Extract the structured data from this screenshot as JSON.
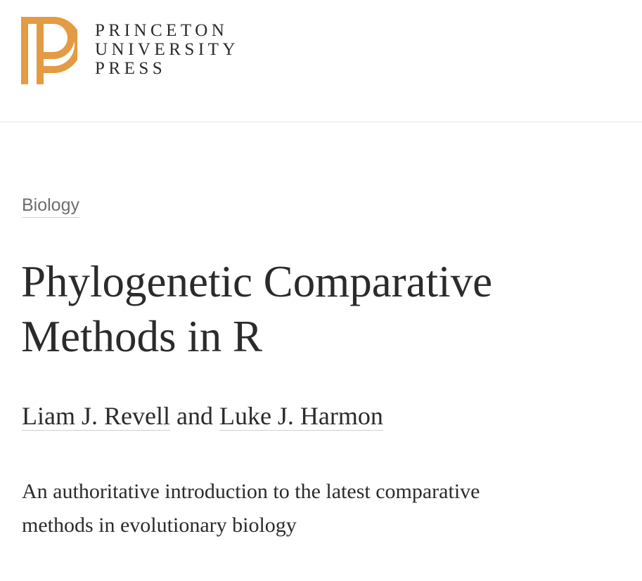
{
  "brand": {
    "logo_lines": [
      "PRINCETON",
      "UNIVERSITY",
      "PRESS"
    ],
    "logo_color": "#E39B44"
  },
  "book": {
    "category": "Biology",
    "title": "Phylogenetic Comparative Methods in R",
    "authors": [
      "Liam J. Revell",
      "Luke J. Harmon"
    ],
    "author_joiner": "and",
    "subtitle": "An authoritative introduction to the latest comparative methods in evolutionary biology"
  }
}
